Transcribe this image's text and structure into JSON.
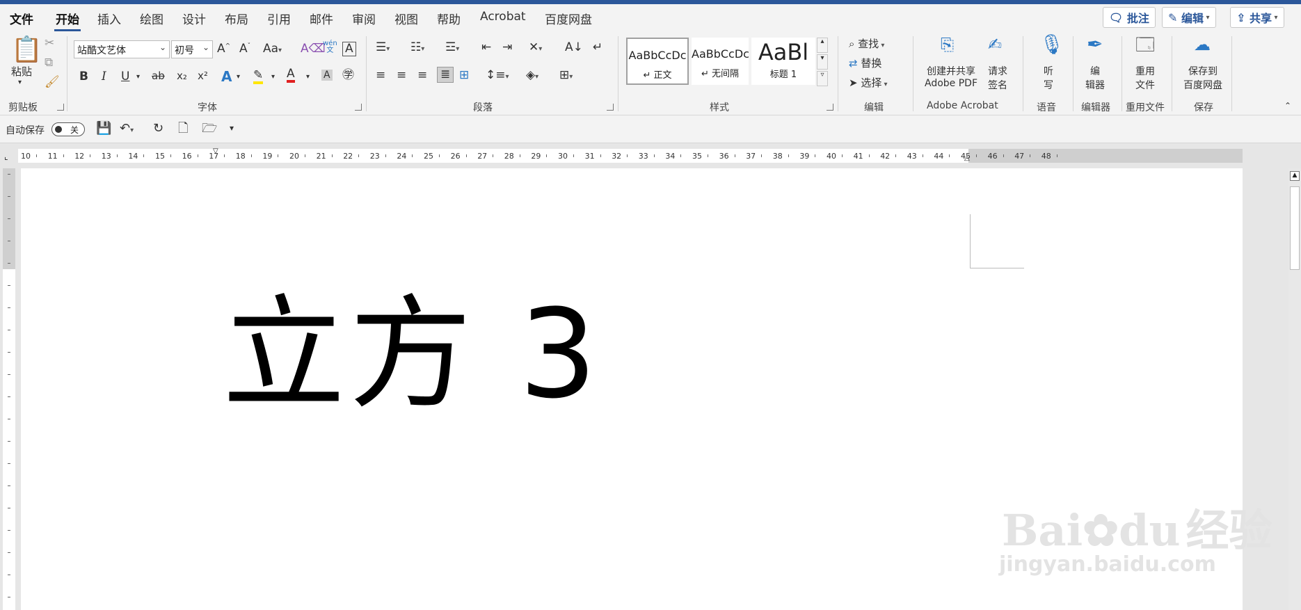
{
  "tabs": [
    "文件",
    "开始",
    "插入",
    "绘图",
    "设计",
    "布局",
    "引用",
    "邮件",
    "审阅",
    "视图",
    "帮助",
    "Acrobat",
    "百度网盘"
  ],
  "right_buttons": {
    "comments": "批注",
    "edit": "编辑",
    "share": "共享"
  },
  "clipboard": {
    "paste": "粘贴",
    "group": "剪贴板"
  },
  "font": {
    "name": "站酷文艺体",
    "size": "初号",
    "grow": "A^",
    "shrink": "A˅",
    "case": "Aa",
    "phonetic": "wén",
    "group": "字体",
    "bold": "B",
    "italic": "I",
    "underline": "U",
    "strike": "ab",
    "sub": "x₂",
    "sup": "x²"
  },
  "paragraph": {
    "group": "段落"
  },
  "styles": {
    "group": "样式",
    "items": [
      {
        "preview": "AaBbCcDc",
        "name": "↵ 正文"
      },
      {
        "preview": "AaBbCcDc",
        "name": "↵ 无间隔"
      },
      {
        "preview": "AaBl",
        "name": "标题 1"
      }
    ]
  },
  "editing": {
    "find": "查找",
    "replace": "替换",
    "select": "选择",
    "group": "编辑"
  },
  "acrobat": {
    "create_line1": "创建并共享",
    "create_line2": "Adobe PDF",
    "sign_line1": "请求",
    "sign_line2": "签名",
    "group": "Adobe Acrobat"
  },
  "voice": {
    "dictate_line1": "听",
    "dictate_line2": "写",
    "group": "语音"
  },
  "editor": {
    "line1": "编",
    "line2": "辑器",
    "group": "编辑器"
  },
  "reuse": {
    "line1": "重用",
    "line2": "文件",
    "group": "重用文件"
  },
  "save": {
    "line1": "保存到",
    "line2": "百度网盘",
    "group": "保存"
  },
  "qat": {
    "autosave": "自动保存",
    "toggle": "关"
  },
  "ruler": {
    "numbers": [
      "10",
      "11",
      "12",
      "13",
      "14",
      "15",
      "16",
      "17",
      "18",
      "19",
      "20",
      "21",
      "22",
      "23",
      "24",
      "25",
      "26",
      "27",
      "28",
      "29",
      "30",
      "31",
      "32",
      "33",
      "34",
      "35",
      "36",
      "37",
      "38",
      "39",
      "40",
      "41",
      "42",
      "43",
      "44",
      "45",
      "46",
      "47",
      "48"
    ]
  },
  "document": {
    "text": "立方 3"
  },
  "watermark": {
    "brand": "Bai",
    "brand2": "du",
    "cn": "经验",
    "url": "jingyan.baidu.com"
  }
}
